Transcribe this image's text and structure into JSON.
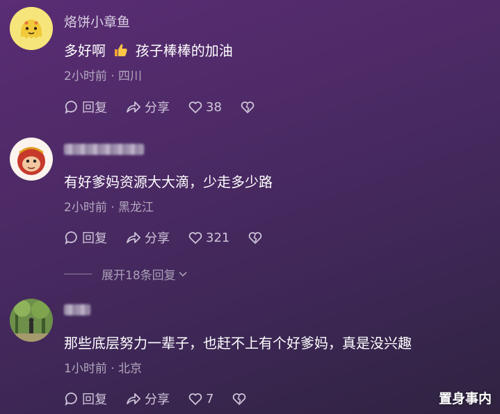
{
  "comments": [
    {
      "username": "烙饼小章鱼",
      "text": "多好啊",
      "text_after": "孩子棒棒的加油",
      "emoji_name": "thumbs-up",
      "meta": "2小时前 · 四川",
      "reply_label": "回复",
      "share_label": "分享",
      "likes": "38"
    },
    {
      "username": "",
      "text": "有好爹妈资源大大滴，少走多少路",
      "meta": "2小时前 · 黑龙江",
      "reply_label": "回复",
      "share_label": "分享",
      "likes": "321"
    },
    {
      "username": "",
      "text": "那些底层努力一辈子，也赶不上有个好爹妈，真是没兴趣",
      "meta": "1小时前 · 北京",
      "reply_label": "回复",
      "share_label": "分享",
      "likes": "7"
    }
  ],
  "expand_replies_label": "展开18条回复",
  "watermark": "置身事内",
  "colors": {
    "background": "#4d2a66",
    "meta": "#b2a8bf",
    "action": "#cfc6da"
  }
}
